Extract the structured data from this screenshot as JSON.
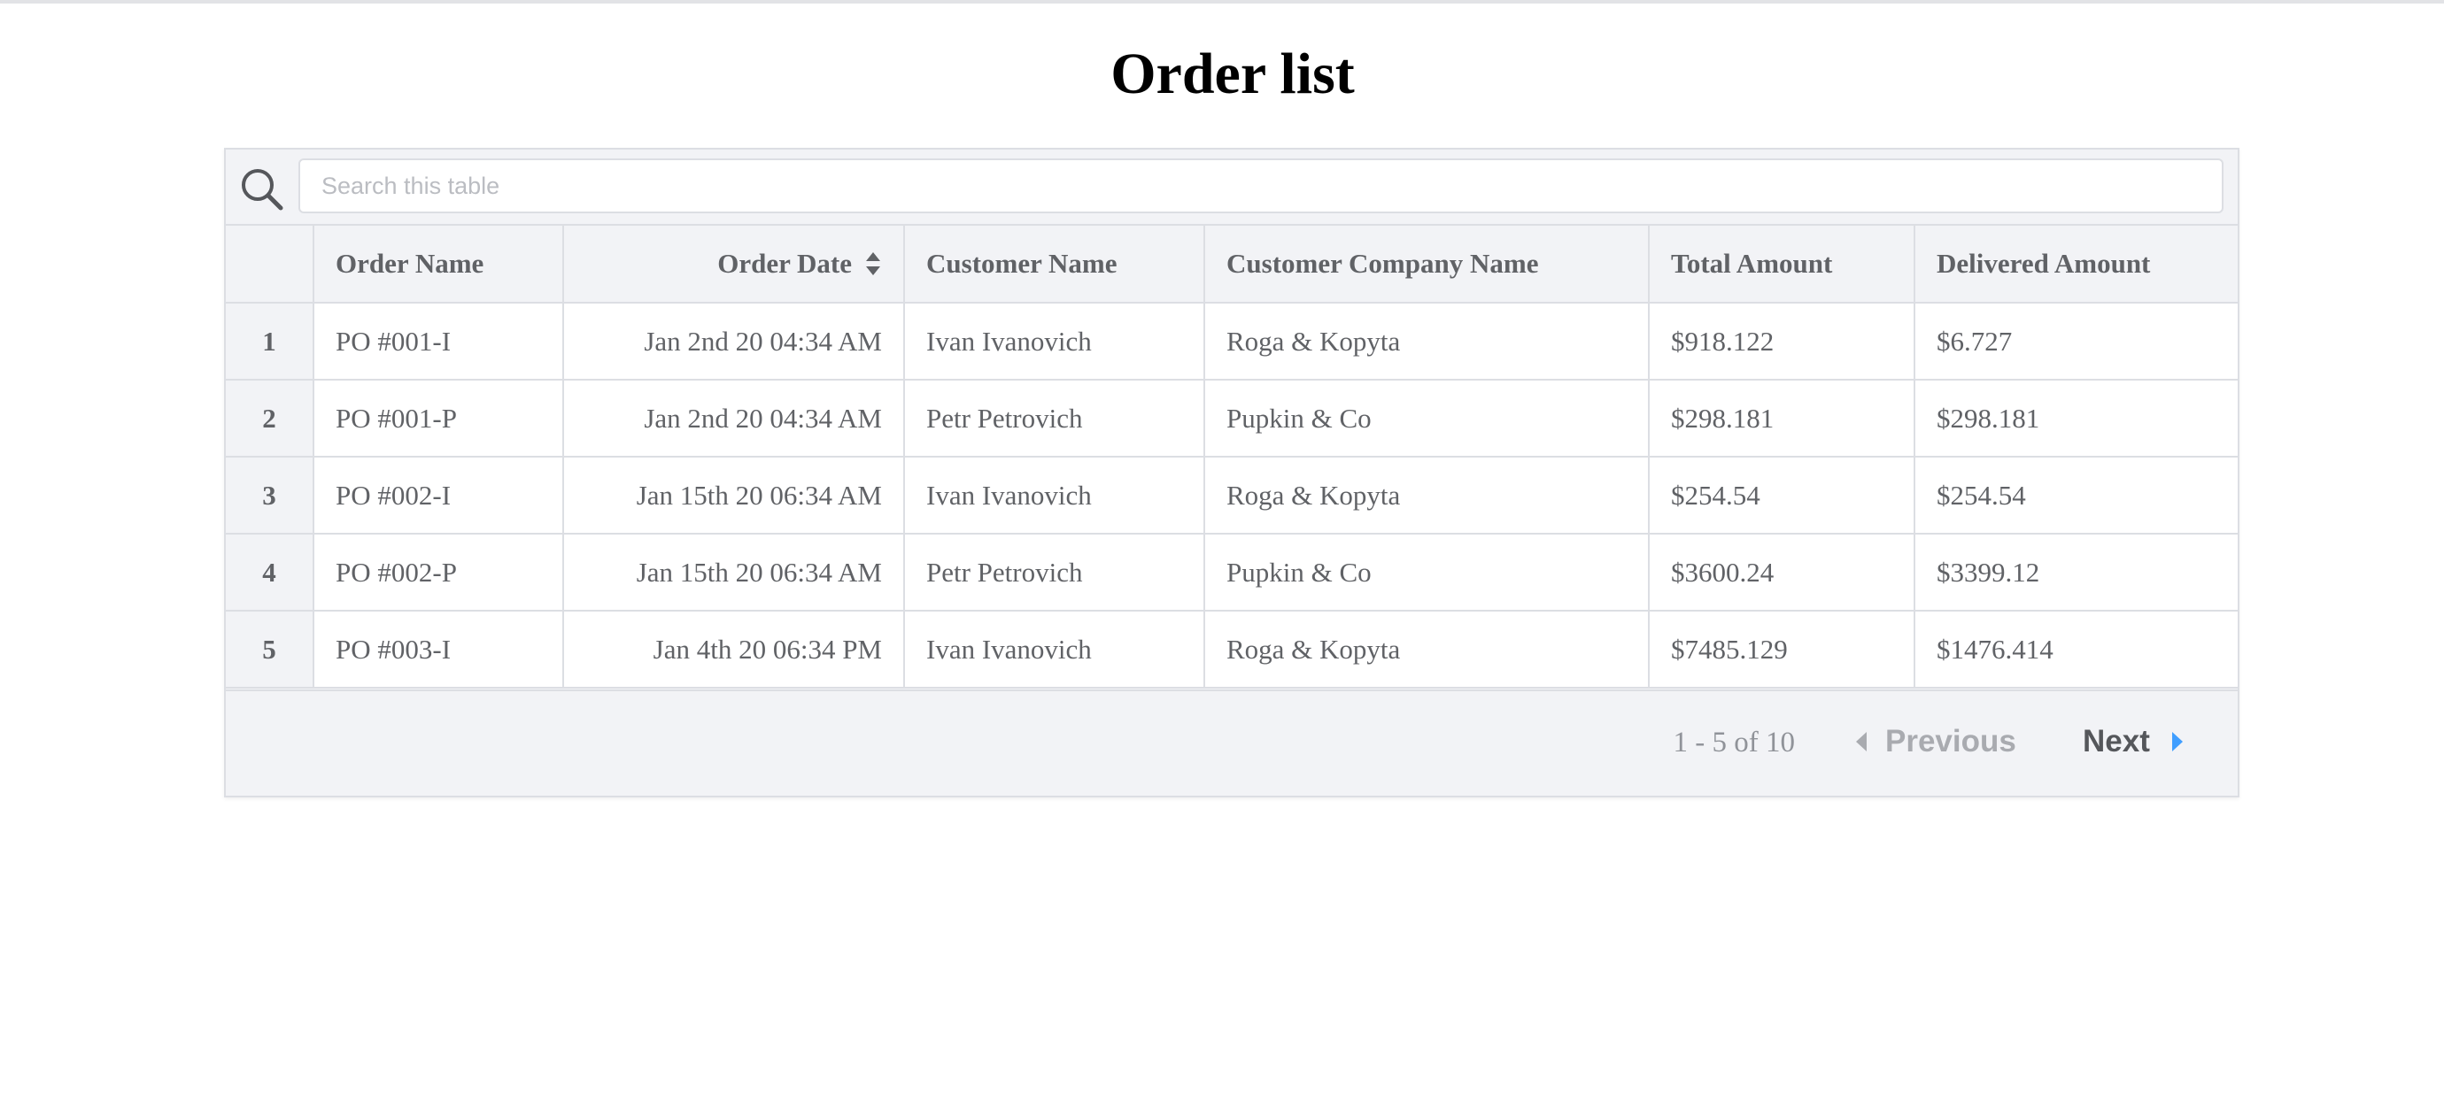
{
  "page": {
    "title": "Order list"
  },
  "search": {
    "placeholder": "Search this table",
    "value": ""
  },
  "table": {
    "columns": [
      {
        "label": "",
        "key": "idx"
      },
      {
        "label": "Order Name",
        "key": "order_name"
      },
      {
        "label": "Order Date",
        "key": "order_date",
        "sortable": true
      },
      {
        "label": "Customer Name",
        "key": "customer_name"
      },
      {
        "label": "Customer Company Name",
        "key": "company"
      },
      {
        "label": "Total Amount",
        "key": "total"
      },
      {
        "label": "Delivered Amount",
        "key": "delivered"
      }
    ],
    "rows": [
      {
        "idx": "1",
        "order_name": "PO #001-I",
        "order_date": "Jan 2nd 20 04:34 AM",
        "customer_name": "Ivan Ivanovich",
        "company": "Roga & Kopyta",
        "total": "$918.122",
        "delivered": "$6.727"
      },
      {
        "idx": "2",
        "order_name": "PO #001-P",
        "order_date": "Jan 2nd 20 04:34 AM",
        "customer_name": "Petr Petrovich",
        "company": "Pupkin & Co",
        "total": "$298.181",
        "delivered": "$298.181"
      },
      {
        "idx": "3",
        "order_name": "PO #002-I",
        "order_date": "Jan 15th 20 06:34 AM",
        "customer_name": "Ivan Ivanovich",
        "company": "Roga & Kopyta",
        "total": "$254.54",
        "delivered": "$254.54"
      },
      {
        "idx": "4",
        "order_name": "PO #002-P",
        "order_date": "Jan 15th 20 06:34 AM",
        "customer_name": "Petr Petrovich",
        "company": "Pupkin & Co",
        "total": "$3600.24",
        "delivered": "$3399.12"
      },
      {
        "idx": "5",
        "order_name": "PO #003-I",
        "order_date": "Jan 4th 20 06:34 PM",
        "customer_name": "Ivan Ivanovich",
        "company": "Roga & Kopyta",
        "total": "$7485.129",
        "delivered": "$1476.414"
      }
    ]
  },
  "pagination": {
    "info": "1 - 5 of 10",
    "previous_label": "Previous",
    "next_label": "Next"
  },
  "colors": {
    "header_bg": "#f2f3f6",
    "border": "#dcdee3",
    "text": "#606266",
    "accent": "#409eff",
    "disabled": "#a9abb0"
  },
  "icons": {
    "search": "search-icon",
    "sort": "sort-icon",
    "prev": "chevron-left-icon",
    "next": "chevron-right-icon"
  }
}
